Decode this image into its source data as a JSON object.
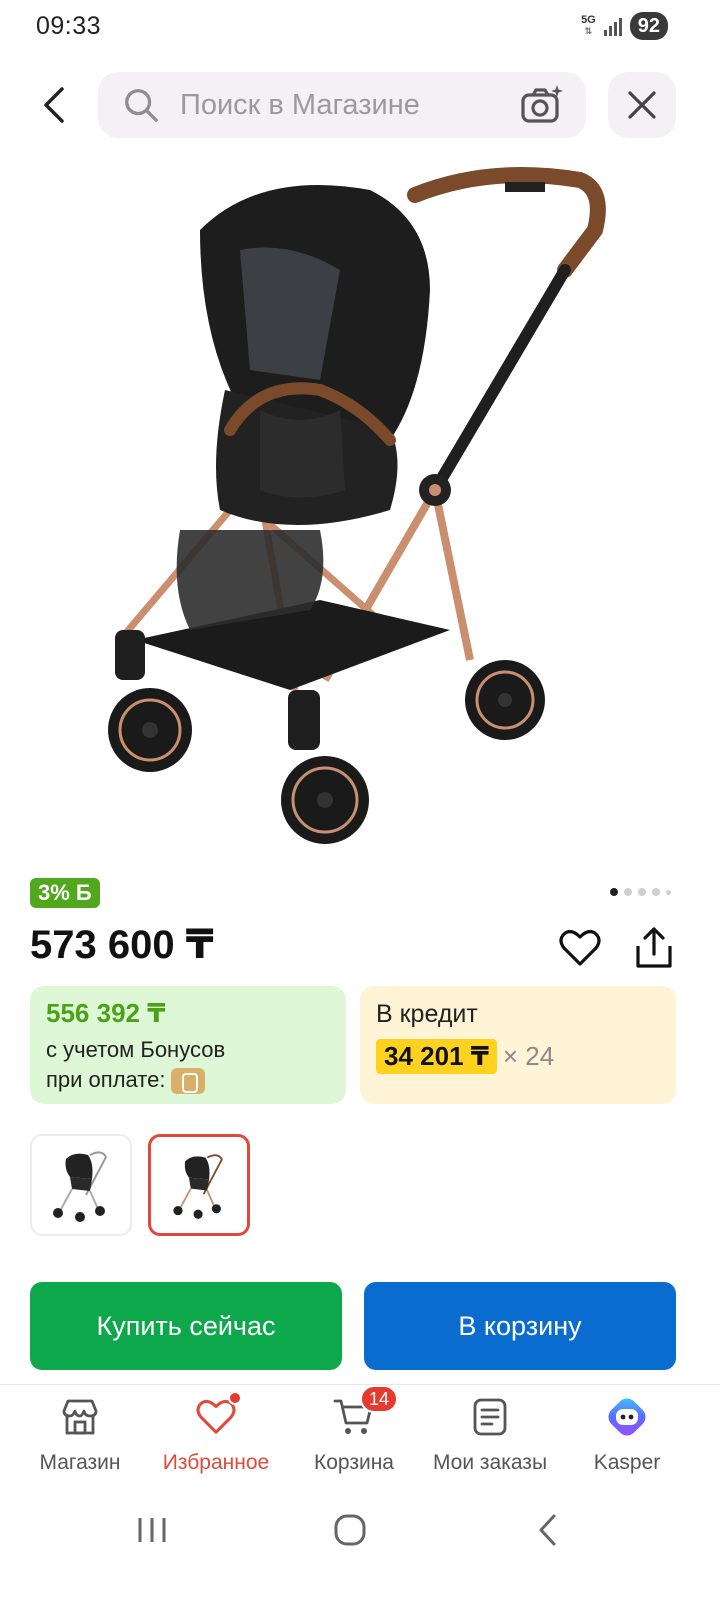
{
  "status_bar": {
    "time": "09:33",
    "network": "5G",
    "battery": "92"
  },
  "search": {
    "placeholder": "Поиск в Магазине"
  },
  "product": {
    "bonus_badge": "3% Б",
    "price": "573 600 ₸",
    "bonus_price": "556 392 ₸",
    "bonus_line1": "с учетом Бонусов",
    "bonus_line2": "при оплате:",
    "credit_title": "В кредит",
    "credit_amount": "34 201 ₸",
    "credit_months": "× 24"
  },
  "buttons": {
    "buy_now": "Купить сейчас",
    "add_to_cart": "В корзину"
  },
  "nav": {
    "items": [
      {
        "label": "Магазин",
        "icon": "shop-icon"
      },
      {
        "label": "Избранное",
        "icon": "heart-icon",
        "active": true
      },
      {
        "label": "Корзина",
        "icon": "cart-icon",
        "badge": "14"
      },
      {
        "label": "Мои заказы",
        "icon": "orders-icon"
      },
      {
        "label": "Kasper",
        "icon": "kasper-icon"
      }
    ]
  },
  "colors": {
    "accent_red": "#e04a3a",
    "bonus_green": "#4aa316",
    "buy_green": "#0ea84c",
    "cart_blue": "#0b6ccf",
    "credit_yellow": "#ffd21f"
  }
}
